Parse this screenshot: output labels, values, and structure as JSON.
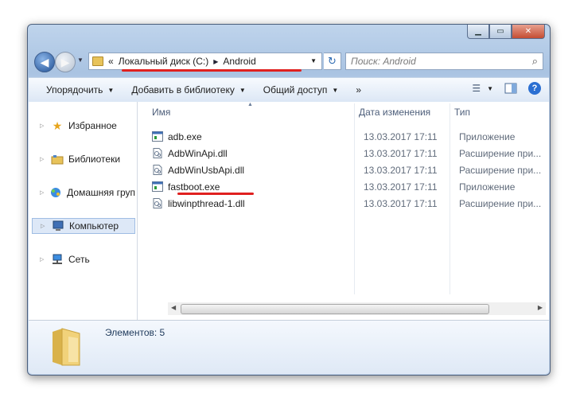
{
  "address": {
    "overflow": "«",
    "crumbs": [
      "Локальный диск (C:)",
      "Android"
    ]
  },
  "search": {
    "placeholder": "Поиск: Android"
  },
  "toolbar": {
    "organize": "Упорядочить",
    "add_library": "Добавить в библиотеку",
    "share": "Общий доступ",
    "more": "»"
  },
  "nav": {
    "items": [
      {
        "label": "Избранное",
        "icon": "star-icon"
      },
      {
        "label": "Библиотеки",
        "icon": "library-icon"
      },
      {
        "label": "Домашняя груп",
        "icon": "homegroup-icon"
      },
      {
        "label": "Компьютер",
        "icon": "computer-icon"
      },
      {
        "label": "Сеть",
        "icon": "network-icon"
      }
    ]
  },
  "columns": {
    "name": "Имя",
    "date": "Дата изменения",
    "type": "Тип"
  },
  "files": [
    {
      "name": "adb.exe",
      "date": "13.03.2017 17:11",
      "type": "Приложение",
      "icon": "exe-icon"
    },
    {
      "name": "AdbWinApi.dll",
      "date": "13.03.2017 17:11",
      "type": "Расширение при...",
      "icon": "dll-icon"
    },
    {
      "name": "AdbWinUsbApi.dll",
      "date": "13.03.2017 17:11",
      "type": "Расширение при...",
      "icon": "dll-icon"
    },
    {
      "name": "fastboot.exe",
      "date": "13.03.2017 17:11",
      "type": "Приложение",
      "icon": "exe-icon"
    },
    {
      "name": "libwinpthread-1.dll",
      "date": "13.03.2017 17:11",
      "type": "Расширение при...",
      "icon": "dll-icon"
    }
  ],
  "details": {
    "count_text": "Элементов: 5"
  },
  "colors": {
    "highlight": "#e0201f",
    "selection": "#dde8f7",
    "toolbar": "#dce7f5"
  }
}
